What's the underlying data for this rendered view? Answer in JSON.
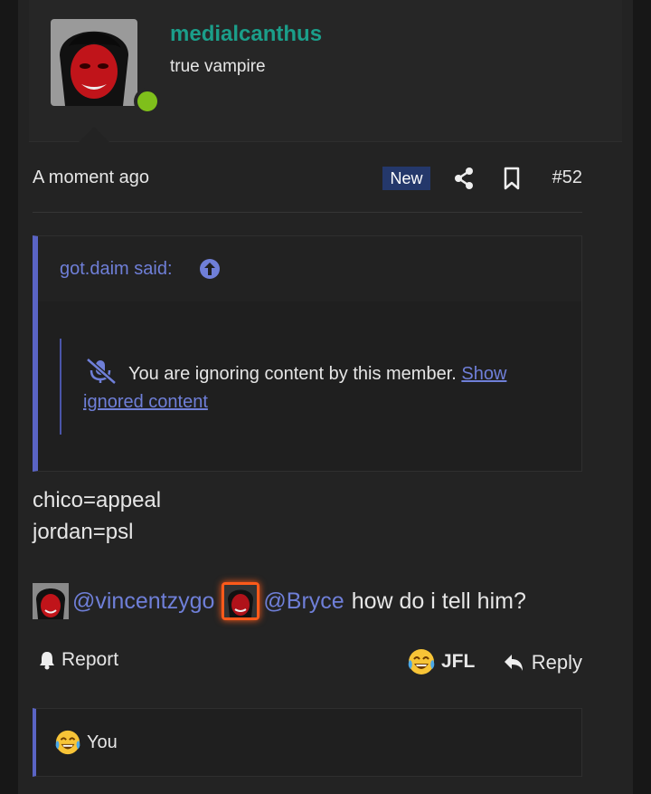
{
  "user": {
    "username": "medialcanthus",
    "title": "true vampire"
  },
  "post_meta": {
    "time": "A moment ago",
    "badge": "New",
    "number": "#52"
  },
  "quote": {
    "author": "got.daim said:",
    "ignored_text": "You are ignoring content by this member.",
    "ignored_link": "Show ignored content"
  },
  "body": {
    "line1": "chico=appeal",
    "line2": "jordan=psl",
    "mention1": "@vincentzygo",
    "mention2": "@Bryce",
    "tail": "how do i tell him?"
  },
  "actions": {
    "report": "Report",
    "reaction": "JFL",
    "reply": "Reply"
  },
  "reactions": {
    "label": "You"
  },
  "colors": {
    "accent": "#6f7fd8",
    "username": "#1b9e8a",
    "online": "#7fbf1b",
    "badge_bg": "#24386b"
  }
}
